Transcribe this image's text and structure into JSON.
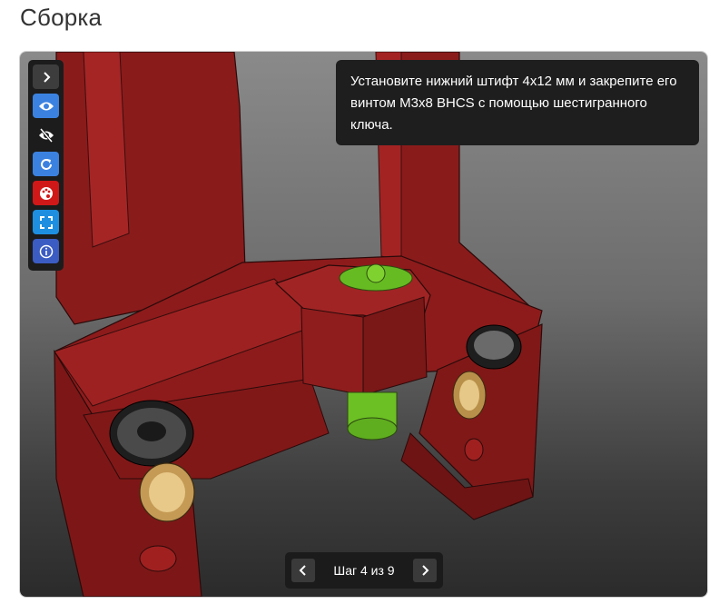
{
  "page": {
    "title": "Сборка"
  },
  "viewer": {
    "instruction": "Установите нижний штифт 4x12 мм и закрепите его винтом M3x8 BHCS с помощью шестигранного ключа.",
    "colors": {
      "part": "#8e1c1c",
      "pin": "#6cc024",
      "background_top": "#8a8a8a",
      "background_bottom": "#2b2b2b"
    }
  },
  "toolbar": {
    "buttons": [
      {
        "name": "expand",
        "icon": "chevron-right-icon",
        "color": "#3d3d3d"
      },
      {
        "name": "show",
        "icon": "eye-icon",
        "color": "#3b82e0"
      },
      {
        "name": "hide",
        "icon": "eye-off-icon",
        "color": "#1c1c1c"
      },
      {
        "name": "reset",
        "icon": "rotate-icon",
        "color": "#3b82e0"
      },
      {
        "name": "color",
        "icon": "palette-icon",
        "color": "#d01818"
      },
      {
        "name": "fullscreen",
        "icon": "fullscreen-icon",
        "color": "#1e8fe0"
      },
      {
        "name": "info",
        "icon": "info-icon",
        "color": "#3b5cc2"
      }
    ]
  },
  "stepper": {
    "label": "Шаг 4 из 9",
    "current": 4,
    "total": 9
  }
}
